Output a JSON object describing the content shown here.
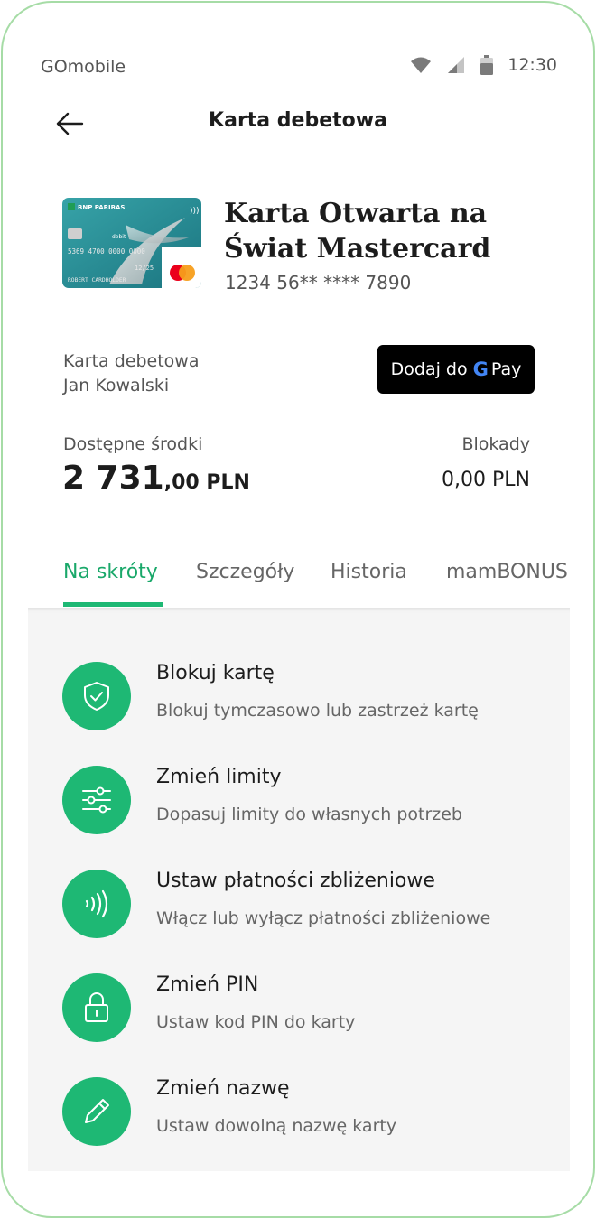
{
  "status_bar": {
    "carrier": "GOmobile",
    "time": "12:30"
  },
  "header": {
    "title": "Karta debetowa"
  },
  "card": {
    "image": {
      "bank_brand": "BNP PARIBAS",
      "type_label": "debit",
      "number_embossed": "5369 4700 0000 0000",
      "expiry": "12/25",
      "holder": "ROBERT CARDHOLDER"
    },
    "name": "Karta Otwarta na Świat Mastercard",
    "number": "1234 56** **** 7890",
    "type": "Karta debetowa",
    "owner": "Jan Kowalski"
  },
  "gpay": {
    "prefix": "Dodaj do",
    "g": "G",
    "pay": "Pay"
  },
  "balance": {
    "available_label": "Dostępne środki",
    "available_main": "2 731",
    "available_rest": ",00 PLN",
    "blocked_label": "Blokady",
    "blocked_value": "0,00 PLN"
  },
  "tabs": [
    {
      "label": "Na skróty",
      "active": true
    },
    {
      "label": "Szczegóły",
      "active": false
    },
    {
      "label": "Historia",
      "active": false
    },
    {
      "label": "mamBONUS",
      "active": false
    }
  ],
  "actions": [
    {
      "title": "Blokuj kartę",
      "description": "Blokuj tymczasowo lub zastrzeż kartę",
      "icon": "shield-check-icon"
    },
    {
      "title": "Zmień limity",
      "description": "Dopasuj limity do własnych potrzeb",
      "icon": "sliders-icon"
    },
    {
      "title": "Ustaw płatności zbliżeniowe",
      "description": "Włącz lub wyłącz płatności zbliżeniowe",
      "icon": "contactless-icon"
    },
    {
      "title": "Zmień PIN",
      "description": "Ustaw kod PIN do karty",
      "icon": "lock-icon"
    },
    {
      "title": "Zmień nazwę",
      "description": "Ustaw dowolną nazwę karty",
      "icon": "pencil-icon"
    }
  ],
  "colors": {
    "accent": "#1eb874",
    "frame": "#a6dca6",
    "card_bg": "#2a8f97"
  }
}
